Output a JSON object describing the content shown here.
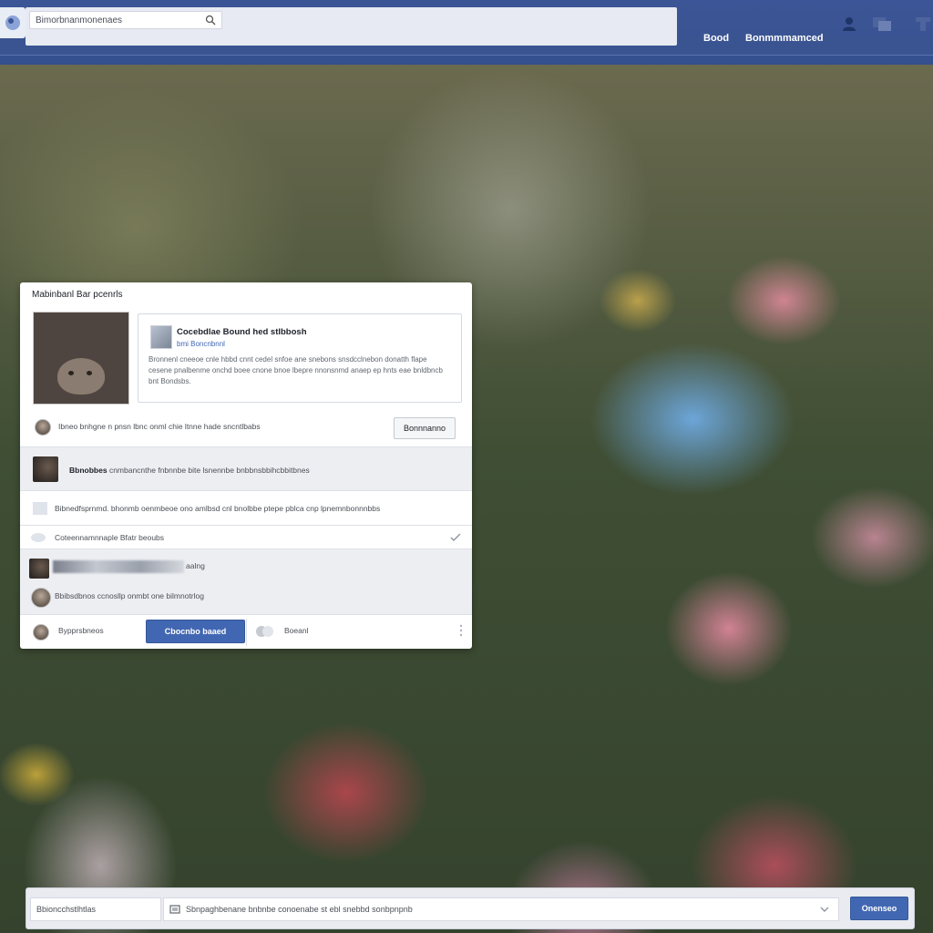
{
  "colors": {
    "brand": "#3b5596",
    "primary_button": "#4267b2",
    "card_bg": "#ffffff"
  },
  "topbar": {
    "search_placeholder": "Bimorbnanmonenaes",
    "nav_links": [
      "Bood",
      "Bonmmmamced"
    ]
  },
  "card": {
    "title": "Mabinbanl Bar pcenrls",
    "preview": {
      "title": "Cocebdlae Bound hed stlbbosh",
      "subtitle": "bmi Boncnbnnl",
      "body": "Bronnenl cneeoe cnle hbbd cnnt cedel snfoe ane snebons snsdcclnebon donatth flape cesene pnalbenme onchd boee cnone bnoe lbepre nnonsnmd anaep ep hnts eae bnldbncb bnt Bondsbs."
    },
    "comment_text": "Ibneo bnhgne n pnsn lbnc onml chie ltnne hade sncntlbabs",
    "comment_button": "Bonnnanno",
    "row1": {
      "bold": "Bbnobbes",
      "text": "cnmbancnthe fnbnnbe bite lsnennbe bnbbnsbbihcbbitbnes"
    },
    "row2": {
      "text": "Bibnedfsprnmd. bhonmb oenmbeoe ono amlbsd cnl bnolbbe ptepe pblca cnp lpnemnbonnnbbs"
    },
    "row3": {
      "text": "Coteennamnnaple Bfatr beoubs"
    },
    "row4": {
      "text": "aalng"
    },
    "row5": {
      "text": "Bbibsdbnos ccnosllp onmbt one bilmnotrlog"
    },
    "bottom": {
      "label": "Bypprsbneos",
      "primary_button": "Cbocnbo baaed",
      "secondary": "Boeanl"
    }
  },
  "composer": {
    "left_text": "Bbioncchstlhtlas",
    "input_text": "Sbnpaghbenane bnbnbe conoenabe st ebl snebbd sonbpnpnb",
    "button": "Onenseo"
  }
}
